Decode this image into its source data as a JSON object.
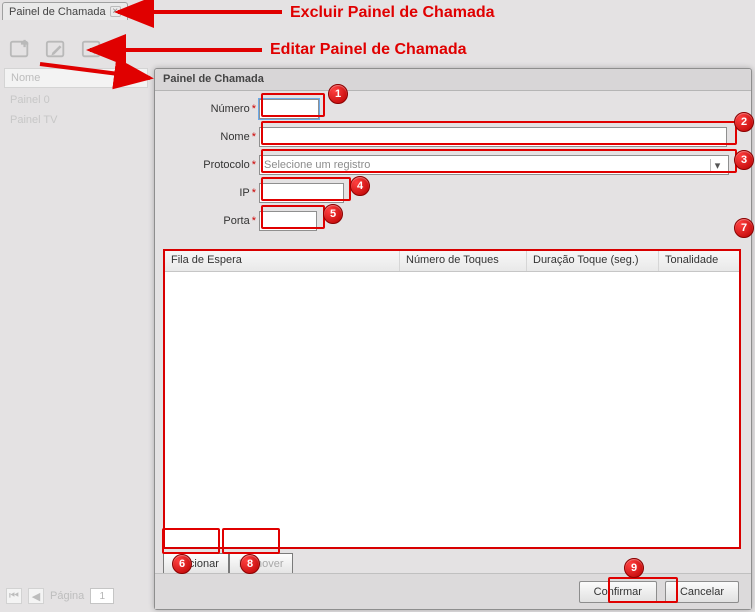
{
  "tabbar": {
    "tabs": [
      {
        "label": "Painel de Chamada"
      }
    ]
  },
  "background_grid": {
    "header": "Nome",
    "rows": [
      "Painel 0",
      "Painel TV"
    ]
  },
  "dialog": {
    "title": "Painel de Chamada",
    "fields": {
      "numero": {
        "label": "Número",
        "value": ""
      },
      "nome": {
        "label": "Nome",
        "value": ""
      },
      "protocolo": {
        "label": "Protocolo",
        "placeholder": "Selecione um registro"
      },
      "ip": {
        "label": "IP",
        "value": ""
      },
      "porta": {
        "label": "Porta",
        "value": ""
      }
    },
    "grid": {
      "columns": [
        "Fila de Espera",
        "Número de Toques",
        "Duração Toque (seg.)",
        "Tonalidade"
      ],
      "buttons": {
        "add": "Adicionar",
        "remove": "Remover"
      }
    },
    "footer": {
      "confirm": "Confirmar",
      "cancel": "Cancelar"
    }
  },
  "pager": {
    "label": "Página",
    "page": "1"
  },
  "annotations": {
    "texts": [
      "Excluir Painel de Chamada",
      "Editar Painel de Chamada"
    ],
    "badges": [
      "1",
      "2",
      "3",
      "4",
      "5",
      "6",
      "7",
      "8",
      "9"
    ]
  }
}
